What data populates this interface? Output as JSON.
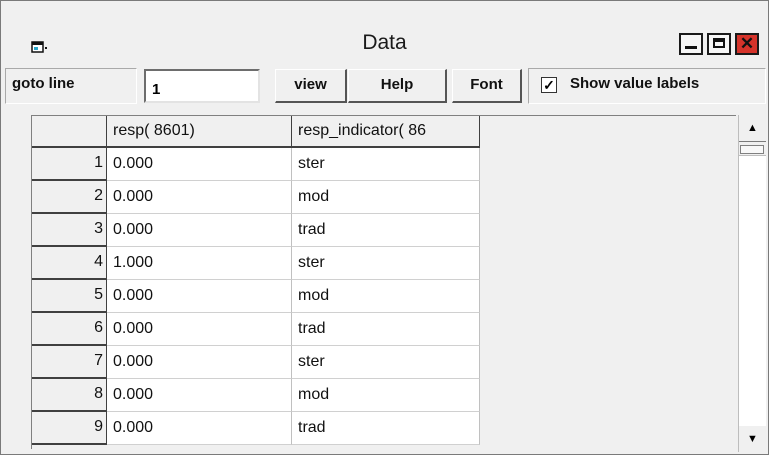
{
  "window": {
    "title": "Data",
    "icon": "app-window-icon",
    "controls": {
      "minimize": "minimize-icon",
      "maximize": "maximize-icon",
      "close_glyph": "✕"
    }
  },
  "toolbar": {
    "goto_label": "goto line",
    "goto_value": "1",
    "view_label": "view",
    "help_label": "Help",
    "font_label": "Font",
    "show_value_labels": "Show value labels",
    "show_value_labels_checked": true,
    "checkmark": "✓"
  },
  "table": {
    "columns": [
      "resp( 8601)",
      "resp_indicator( 86"
    ],
    "rows": [
      {
        "n": "1",
        "resp": "0.000",
        "indicator": "ster"
      },
      {
        "n": "2",
        "resp": "0.000",
        "indicator": "mod"
      },
      {
        "n": "3",
        "resp": "0.000",
        "indicator": "trad"
      },
      {
        "n": "4",
        "resp": "1.000",
        "indicator": "ster"
      },
      {
        "n": "5",
        "resp": "0.000",
        "indicator": "mod"
      },
      {
        "n": "6",
        "resp": "0.000",
        "indicator": "trad"
      },
      {
        "n": "7",
        "resp": "0.000",
        "indicator": "ster"
      },
      {
        "n": "8",
        "resp": "0.000",
        "indicator": "mod"
      },
      {
        "n": "9",
        "resp": "0.000",
        "indicator": "trad"
      }
    ]
  },
  "scrollbar": {
    "up_glyph": "▲",
    "down_glyph": "▼"
  },
  "colors": {
    "close_button": "#d5332a",
    "window_bg": "#f0f0f0"
  }
}
